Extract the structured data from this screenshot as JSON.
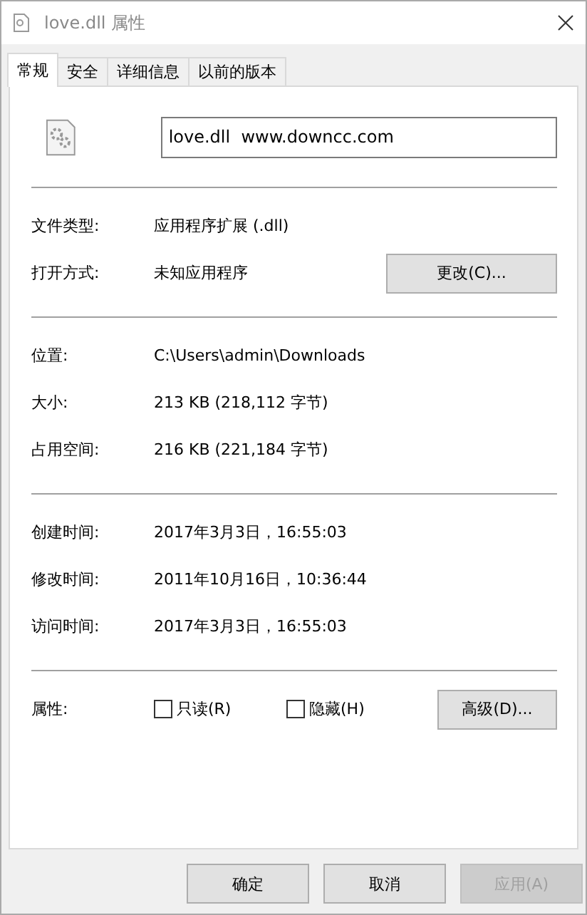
{
  "window": {
    "title": "love.dll 属性"
  },
  "tabs": [
    {
      "label": "常规",
      "selected": true
    },
    {
      "label": "安全",
      "selected": false
    },
    {
      "label": "详细信息",
      "selected": false
    },
    {
      "label": "以前的版本",
      "selected": false
    }
  ],
  "name_field": {
    "value": "love.dll  www.downcc.com"
  },
  "sections": [
    [
      {
        "label": "文件类型:",
        "value": "应用程序扩展 (.dll)"
      },
      {
        "label": "打开方式:",
        "value": "未知应用程序",
        "button": "更改(C)..."
      }
    ],
    [
      {
        "label": "位置:",
        "value": "C:\\Users\\admin\\Downloads"
      },
      {
        "label": "大小:",
        "value": "213 KB (218,112 字节)"
      },
      {
        "label": "占用空间:",
        "value": "216 KB (221,184 字节)"
      }
    ],
    [
      {
        "label": "创建时间:",
        "value": "2017年3月3日，16:55:03"
      },
      {
        "label": "修改时间:",
        "value": "2011年10月16日，10:36:44"
      },
      {
        "label": "访问时间:",
        "value": "2017年3月3日，16:55:03"
      }
    ]
  ],
  "attributes": {
    "label": "属性:",
    "checkboxes": [
      {
        "label": "只读(R)",
        "checked": false
      },
      {
        "label": "隐藏(H)",
        "checked": false
      }
    ],
    "button": "高级(D)..."
  },
  "buttons": [
    {
      "label": "确定",
      "disabled": false
    },
    {
      "label": "取消",
      "disabled": false
    },
    {
      "label": "应用(A)",
      "disabled": true
    }
  ]
}
